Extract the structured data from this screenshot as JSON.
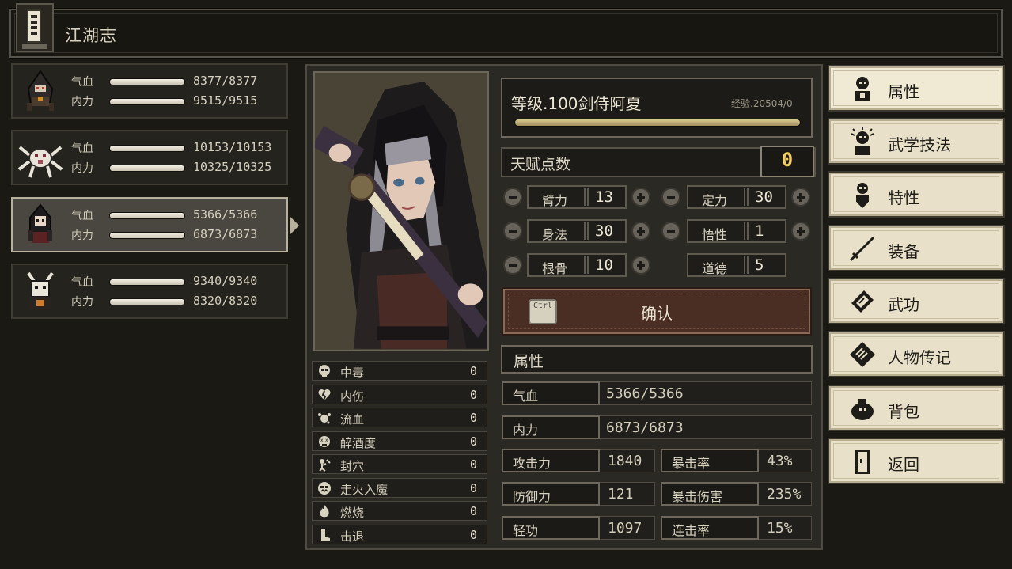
{
  "window": {
    "title": "江湖志"
  },
  "party": [
    {
      "hp_label": "气血",
      "hp": "8377/8377",
      "hp_fill": 1.0,
      "mp_label": "内力",
      "mp": "9515/9515",
      "mp_fill": 1.0
    },
    {
      "hp_label": "气血",
      "hp": "10153/10153",
      "hp_fill": 1.0,
      "mp_label": "内力",
      "mp": "10325/10325",
      "mp_fill": 1.0
    },
    {
      "hp_label": "气血",
      "hp": "5366/5366",
      "hp_fill": 1.0,
      "mp_label": "内力",
      "mp": "6873/6873",
      "mp_fill": 1.0,
      "selected": true
    },
    {
      "hp_label": "气血",
      "hp": "9340/9340",
      "hp_fill": 1.0,
      "mp_label": "内力",
      "mp": "8320/8320",
      "mp_fill": 1.0
    }
  ],
  "character": {
    "title": "等级.100剑侍阿夏",
    "exp": "经验.20504/0",
    "exp_fill": 1.0
  },
  "talent": {
    "label": "天赋点数",
    "value": "0"
  },
  "attributes": [
    {
      "name": "臂力",
      "value": "13"
    },
    {
      "name": "定力",
      "value": "30"
    },
    {
      "name": "身法",
      "value": "30"
    },
    {
      "name": "悟性",
      "value": "1"
    },
    {
      "name": "根骨",
      "value": "10"
    },
    {
      "name": "道德",
      "value": "5"
    }
  ],
  "confirm": {
    "key": "Ctrl",
    "label": "确认"
  },
  "status_effects": [
    {
      "name": "中毒",
      "value": "0",
      "icon": "skull-icon"
    },
    {
      "name": "内伤",
      "value": "0",
      "icon": "broken-heart-icon"
    },
    {
      "name": "流血",
      "value": "0",
      "icon": "blood-splat-icon"
    },
    {
      "name": "醉酒度",
      "value": "0",
      "icon": "dizzy-face-icon"
    },
    {
      "name": "封穴",
      "value": "0",
      "icon": "acupoint-icon"
    },
    {
      "name": "走火入魔",
      "value": "0",
      "icon": "demon-face-icon"
    },
    {
      "name": "燃烧",
      "value": "0",
      "icon": "flame-icon"
    },
    {
      "name": "击退",
      "value": "0",
      "icon": "boot-icon"
    }
  ],
  "stats": {
    "header": "属性",
    "hp": {
      "label": "气血",
      "value": "5366/5366"
    },
    "mp": {
      "label": "内力",
      "value": "6873/6873"
    },
    "attack": {
      "label": "攻击力",
      "value": "1840"
    },
    "crit": {
      "label": "暴击率",
      "value": "43%"
    },
    "defense": {
      "label": "防御力",
      "value": "121"
    },
    "crit_damage": {
      "label": "暴击伤害",
      "value": "235%"
    },
    "agility": {
      "label": "轻功",
      "value": "1097"
    },
    "combo": {
      "label": "连击率",
      "value": "15%"
    }
  },
  "menu": [
    {
      "label": "属性",
      "icon": "person-icon",
      "active": true
    },
    {
      "label": "武学技法",
      "icon": "person-aura-icon"
    },
    {
      "label": "特性",
      "icon": "person-heart-icon"
    },
    {
      "label": "装备",
      "icon": "sword-icon"
    },
    {
      "label": "武功",
      "icon": "scroll-book-icon"
    },
    {
      "label": "人物传记",
      "icon": "book-icon"
    },
    {
      "label": "背包",
      "icon": "bag-icon"
    },
    {
      "label": "返回",
      "icon": "door-icon"
    }
  ],
  "colors": {
    "accent_gold": "#f3ce5c",
    "confirm_bg": "#4a2e24",
    "menu_bg": "#e8e0c8"
  }
}
